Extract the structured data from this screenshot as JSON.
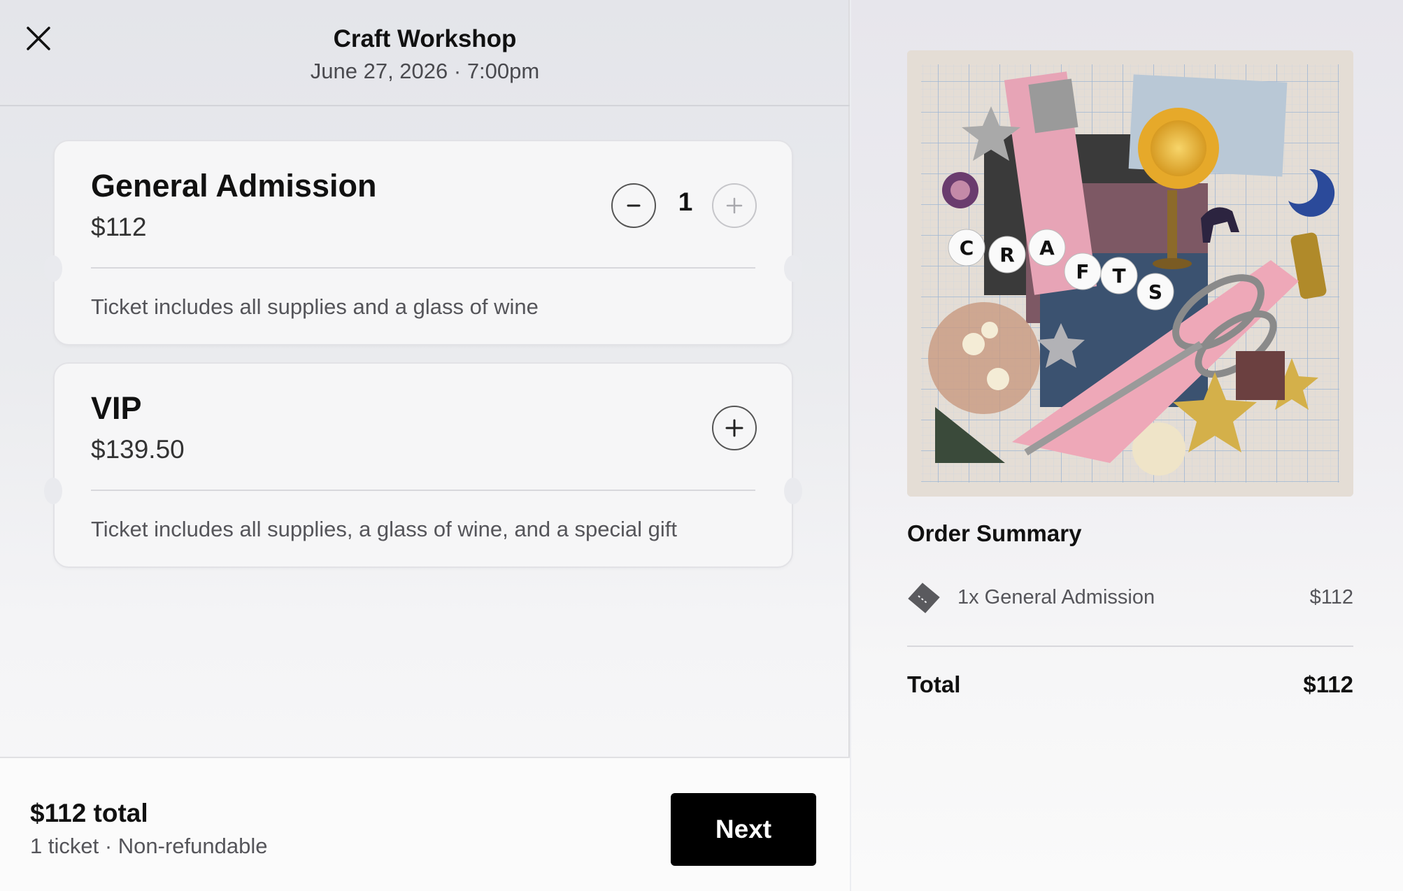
{
  "event": {
    "title": "Craft Workshop",
    "datetime": "June 27, 2026 · 7:00pm"
  },
  "tickets": [
    {
      "name": "General Admission",
      "price": "$112",
      "quantity": "1",
      "description": "Ticket includes all supplies and a glass of wine"
    },
    {
      "name": "VIP",
      "price": "$139.50",
      "description": "Ticket includes all supplies, a glass of wine, and a special gift"
    }
  ],
  "footer": {
    "total": "$112 total",
    "subtext": "1 ticket · Non-refundable",
    "next_label": "Next"
  },
  "artwork": {
    "letters": [
      "C",
      "R",
      "A",
      "F",
      "T",
      "S"
    ]
  },
  "summary": {
    "title": "Order Summary",
    "items": [
      {
        "label": "1x General Admission",
        "price": "$112"
      }
    ],
    "total_label": "Total",
    "total_value": "$112"
  },
  "icons": {
    "close": "close-icon",
    "minus": "minus-icon",
    "plus": "plus-icon",
    "ticket": "ticket-icon"
  }
}
